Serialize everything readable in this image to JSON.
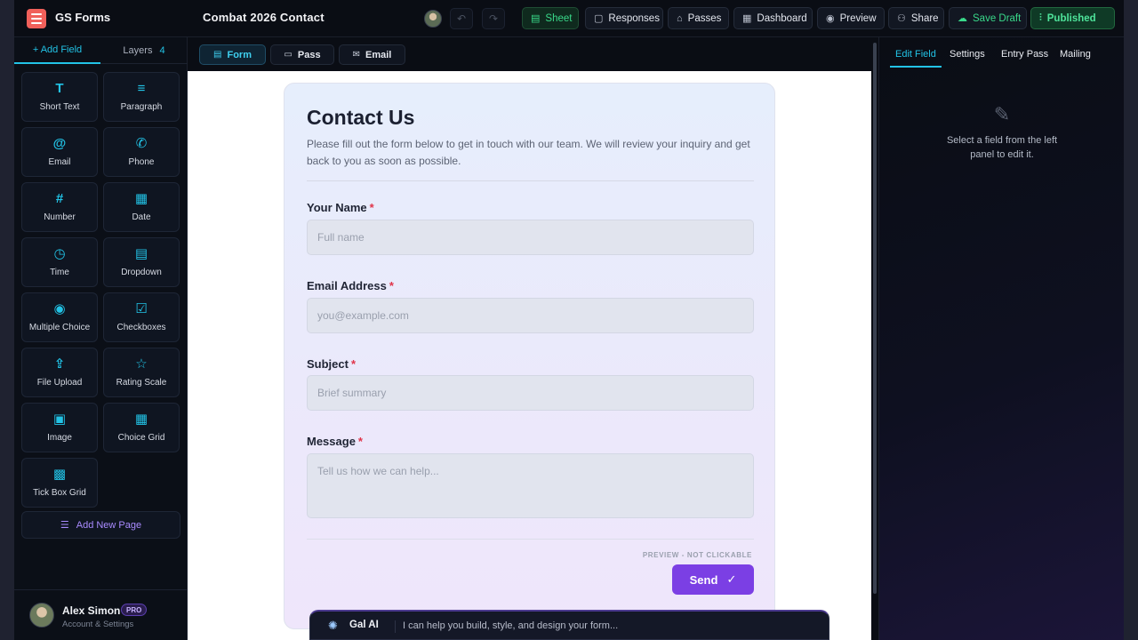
{
  "topbar": {
    "brand": "GS Forms",
    "title": "Combat 2026 Contact",
    "buttons": {
      "sheet": "Sheet",
      "responses": "Responses",
      "passes": "Passes",
      "dashboard": "Dashboard",
      "preview": "Preview",
      "share": "Share",
      "save_draft": "Save Draft",
      "published": "Published"
    }
  },
  "sidebar": {
    "tab_add": "+ Add Field",
    "tab_layers": "Layers",
    "layers_count": "4",
    "fields": [
      {
        "label": "Short Text",
        "icon": "T"
      },
      {
        "label": "Paragraph",
        "icon": "≡"
      },
      {
        "label": "Email",
        "icon": "@"
      },
      {
        "label": "Phone",
        "icon": "✆"
      },
      {
        "label": "Number",
        "icon": "#"
      },
      {
        "label": "Date",
        "icon": "▦"
      },
      {
        "label": "Time",
        "icon": "◷"
      },
      {
        "label": "Dropdown",
        "icon": "▤"
      },
      {
        "label": "Multiple Choice",
        "icon": "◉"
      },
      {
        "label": "Checkboxes",
        "icon": "☑"
      },
      {
        "label": "File Upload",
        "icon": "⇪"
      },
      {
        "label": "Rating Scale",
        "icon": "☆"
      },
      {
        "label": "Image",
        "icon": "▣"
      },
      {
        "label": "Choice Grid",
        "icon": "▦"
      },
      {
        "label": "Tick Box Grid",
        "icon": "▩"
      }
    ],
    "add_page": "Add New Page",
    "account": {
      "name": "Alex Simon",
      "badge": "PRO",
      "subtitle": "Account & Settings"
    }
  },
  "center": {
    "tabs": {
      "form": "Form",
      "pass": "Pass",
      "email": "Email"
    },
    "form": {
      "title": "Contact Us",
      "description": "Please fill out the form below to get in touch with our team. We will review your inquiry and get back to you as soon as possible.",
      "fields": [
        {
          "label": "Your Name",
          "placeholder": "Full name"
        },
        {
          "label": "Email Address",
          "placeholder": "you@example.com"
        },
        {
          "label": "Subject",
          "placeholder": "Brief summary"
        },
        {
          "label": "Message",
          "placeholder": "Tell us how we can help..."
        }
      ],
      "required_mark": "*",
      "preview_note": "PREVIEW - NOT CLICKABLE",
      "submit_label": "Send"
    },
    "ai_bar": {
      "name": "Gal AI",
      "prompt": "I can help you build, style, and design your form..."
    }
  },
  "right_panel": {
    "tabs": {
      "edit_field": "Edit Field",
      "settings": "Settings",
      "entry_pass": "Entry Pass",
      "mailing": "Mailing"
    },
    "empty_message": "Select a field from the left panel to edit it."
  },
  "colors": {
    "accent_cyan": "#22c3e6",
    "accent_green": "#39d98a",
    "accent_purple": "#7b3fe4",
    "required_red": "#e0354a"
  }
}
